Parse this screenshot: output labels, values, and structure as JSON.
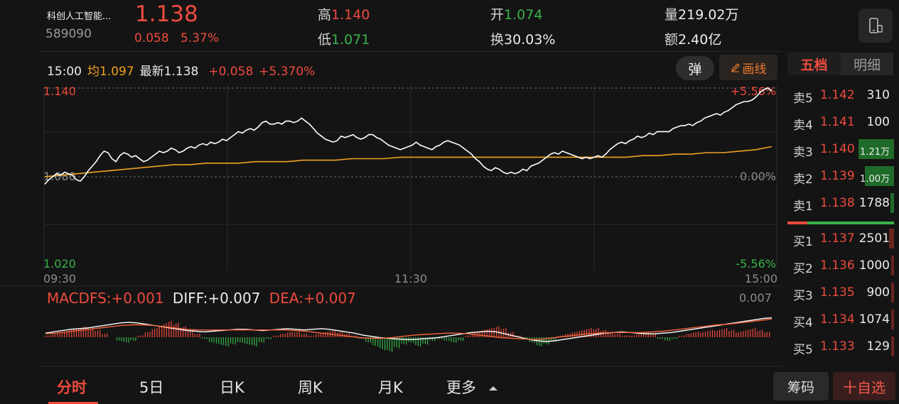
{
  "header": {
    "stock_name": "科创人工智能...",
    "stock_code": "589090",
    "last_price": "1.138",
    "price_change": "0.058",
    "pct_change": "5.37%",
    "high_label": "高",
    "high_value": "1.140",
    "low_label": "低",
    "low_value": "1.071",
    "open_label": "开",
    "open_value": "1.074",
    "turnover_rate_label": "换",
    "turnover_rate_value": "30.03%",
    "volume_label": "量",
    "volume_value": "219.02万",
    "amount_label": "额",
    "amount_value": "2.40亿"
  },
  "chart_info": {
    "time": "15:00",
    "avg_label": "均",
    "avg_value": "1.097",
    "latest_label": "最新",
    "latest_value": "1.138",
    "change": "+0.058",
    "change_pct": "+5.370%",
    "danmu_label": "弹",
    "draw_label": "画线"
  },
  "chart_data": [
    {
      "type": "line",
      "title": "",
      "x_ticks": [
        "09:30",
        "11:30",
        "15:00"
      ],
      "y_left_labels": [
        "1.140",
        "1.080",
        "1.020"
      ],
      "y_right_labels": [
        "+5.56%",
        "0.00%",
        "-5.56%"
      ],
      "ylim": [
        1.02,
        1.14
      ],
      "series": [
        {
          "values": [
            1.076,
            1.079,
            1.081,
            1.083,
            1.082,
            1.084,
            1.083,
            1.082,
            1.079,
            1.078,
            1.081,
            1.085,
            1.088,
            1.091,
            1.095,
            1.098,
            1.097,
            1.093,
            1.091,
            1.095,
            1.097,
            1.096,
            1.094,
            1.095,
            1.093,
            1.091,
            1.092,
            1.094,
            1.096,
            1.098,
            1.097,
            1.098,
            1.1,
            1.099,
            1.097,
            1.098,
            1.1,
            1.101,
            1.1,
            1.102,
            1.103,
            1.102,
            1.104,
            1.103,
            1.104,
            1.106,
            1.105,
            1.107,
            1.109,
            1.111,
            1.11,
            1.112,
            1.113,
            1.112,
            1.114,
            1.117,
            1.118,
            1.116,
            1.116,
            1.117,
            1.116,
            1.118,
            1.118,
            1.117,
            1.118,
            1.12,
            1.118,
            1.116,
            1.113,
            1.11,
            1.108,
            1.106,
            1.105,
            1.104,
            1.105,
            1.108,
            1.107,
            1.108,
            1.109,
            1.107,
            1.106,
            1.107,
            1.109,
            1.109,
            1.107,
            1.106,
            1.104,
            1.102,
            1.101,
            1.1,
            1.099,
            1.1,
            1.101,
            1.102,
            1.104,
            1.102,
            1.101,
            1.1,
            1.099,
            1.101,
            1.102,
            1.104,
            1.105,
            1.104,
            1.103,
            1.102,
            1.1,
            1.098,
            1.096,
            1.093,
            1.091,
            1.088,
            1.086,
            1.085,
            1.087,
            1.086,
            1.084,
            1.083,
            1.084,
            1.083,
            1.084,
            1.086,
            1.085,
            1.088,
            1.089,
            1.09,
            1.092,
            1.094,
            1.096,
            1.097,
            1.096,
            1.098,
            1.097,
            1.096,
            1.095,
            1.094,
            1.093,
            1.094,
            1.093,
            1.094,
            1.095,
            1.094,
            1.096,
            1.099,
            1.101,
            1.103,
            1.104,
            1.103,
            1.105,
            1.106,
            1.108,
            1.107,
            1.108,
            1.11,
            1.109,
            1.111,
            1.111,
            1.111,
            1.111,
            1.113,
            1.114,
            1.115,
            1.115,
            1.116,
            1.115,
            1.117,
            1.118,
            1.12,
            1.121,
            1.122,
            1.123,
            1.122,
            1.124,
            1.125,
            1.127,
            1.129,
            1.13,
            1.131,
            1.131,
            1.132,
            1.134,
            1.137,
            1.139,
            1.14,
            1.138
          ]
        },
        {
          "values": [
            1.081,
            1.082,
            1.083,
            1.084,
            1.085,
            1.086,
            1.087,
            1.088,
            1.089,
            1.089,
            1.09,
            1.09,
            1.09,
            1.091,
            1.091,
            1.091,
            1.092,
            1.092,
            1.092,
            1.093,
            1.093,
            1.093,
            1.094,
            1.094,
            1.094,
            1.094,
            1.094,
            1.094,
            1.094,
            1.094,
            1.094,
            1.094,
            1.094,
            1.094,
            1.094,
            1.094,
            1.094,
            1.095,
            1.095,
            1.096,
            1.096,
            1.097,
            1.097,
            1.098,
            1.099,
            1.101
          ]
        }
      ]
    },
    {
      "type": "bar",
      "title": "",
      "legend": [
        "MACDFS:+0.001",
        "DIFF:+0.007",
        "DEA:+0.007"
      ],
      "y_label_top": "0.007",
      "series": [
        {
          "values": [
            0.1,
            0.2,
            0.3,
            0.4,
            0.5,
            0.6,
            0.5,
            0.4,
            0.2,
            0.0,
            -0.2,
            -0.3,
            -0.2,
            0.1,
            0.3,
            0.5,
            0.7,
            0.9,
            0.8,
            0.6,
            0.4,
            0.2,
            -0.1,
            -0.3,
            -0.4,
            -0.5,
            -0.4,
            -0.3,
            -0.4,
            -0.5,
            -0.3,
            -0.1,
            0.1,
            0.2,
            0.3,
            0.3,
            0.2,
            0.1,
            0.2,
            0.3,
            0.4,
            0.3,
            0.2,
            0.1,
            -0.1,
            -0.3,
            -0.5,
            -0.7,
            -0.8,
            -0.6,
            -0.4,
            -0.3,
            -0.5,
            -0.4,
            -0.2,
            -0.1,
            -0.2,
            -0.3,
            -0.2,
            0.1,
            0.3,
            0.4,
            0.5,
            0.6,
            0.5,
            0.3,
            0.1,
            -0.1,
            -0.3,
            -0.5,
            -0.4,
            -0.2,
            0.1,
            0.2,
            0.3,
            0.4,
            0.5,
            0.5,
            0.4,
            0.3,
            0.2,
            0.1,
            0.1,
            0.2,
            0.3,
            0.2,
            -0.1,
            -0.2,
            -0.1,
            0.1,
            0.2,
            0.3,
            0.3,
            0.4,
            0.4,
            0.5,
            0.4,
            0.3,
            0.4,
            0.5,
            0.4,
            0.3
          ]
        },
        {
          "values": [
            0.2,
            0.4,
            0.6,
            0.8,
            0.9,
            1.0,
            1.2,
            1.4,
            1.6,
            1.8,
            1.9,
            1.8,
            1.6,
            1.4,
            1.2,
            1.0,
            0.8,
            0.6,
            0.5,
            0.4,
            0.5,
            0.6,
            0.7,
            0.8,
            0.8,
            0.7,
            0.6,
            0.7,
            0.8,
            0.9,
            0.8,
            0.7,
            0.8,
            0.9,
            0.8,
            0.6,
            0.4,
            0.2,
            -0.1,
            -0.3,
            -0.5,
            -0.6,
            -0.7,
            -0.8,
            -0.8,
            -0.7,
            -0.6,
            -0.5,
            -0.3,
            -0.1,
            0.1,
            0.3,
            0.4,
            0.5,
            0.4,
            0.1,
            -0.2,
            -0.5,
            -0.8,
            -1.0,
            -1.1,
            -1.0,
            -0.8,
            -0.6,
            -0.4,
            -0.2,
            0.0,
            0.2,
            0.3,
            0.4,
            0.3,
            0.2,
            0.1,
            0.1,
            0.2,
            0.3,
            0.5,
            0.7,
            0.9,
            1.1,
            1.3,
            1.5,
            1.7,
            1.9,
            2.1,
            2.3,
            2.5,
            2.6
          ]
        },
        {
          "values": [
            0.1,
            0.2,
            0.4,
            0.6,
            0.8,
            1.0,
            1.2,
            1.4,
            1.5,
            1.5,
            1.4,
            1.2,
            1.0,
            0.8,
            0.7,
            0.7,
            0.7,
            0.7,
            0.7,
            0.7,
            0.7,
            0.7,
            0.7,
            0.6,
            0.5,
            0.3,
            0.1,
            -0.1,
            -0.3,
            -0.5,
            -0.6,
            -0.6,
            -0.5,
            -0.3,
            -0.1,
            0.0,
            0.1,
            0.2,
            0.2,
            0.1,
            -0.1,
            -0.3,
            -0.5,
            -0.6,
            -0.7,
            -0.8,
            -0.7,
            -0.5,
            -0.3,
            -0.1,
            0.1,
            0.2,
            0.3,
            0.3,
            0.3,
            0.3,
            0.4,
            0.5,
            0.7,
            0.9,
            1.1,
            1.3,
            1.5,
            1.6,
            1.8,
            2.0,
            2.2,
            2.4
          ]
        }
      ]
    }
  ],
  "orderbook": {
    "tab_five": "五档",
    "tab_detail": "明细",
    "asks": [
      {
        "label": "卖5",
        "price": "1.142",
        "volume": "310",
        "bar": 0
      },
      {
        "label": "卖4",
        "price": "1.141",
        "volume": "100",
        "bar": 0
      },
      {
        "label": "卖3",
        "price": "1.140",
        "volume": "1.21万",
        "bar": 1.0
      },
      {
        "label": "卖2",
        "price": "1.139",
        "volume": "1.00万",
        "bar": 0.83
      },
      {
        "label": "卖1",
        "price": "1.138",
        "volume": "1788",
        "bar": 0.1
      }
    ],
    "bids": [
      {
        "label": "买1",
        "price": "1.137",
        "volume": "2501",
        "bar": 0.15
      },
      {
        "label": "买2",
        "price": "1.136",
        "volume": "1000",
        "bar": 0.07
      },
      {
        "label": "买3",
        "price": "1.135",
        "volume": "900",
        "bar": 0.07
      },
      {
        "label": "买4",
        "price": "1.134",
        "volume": "1074",
        "bar": 0.08
      },
      {
        "label": "买5",
        "price": "1.133",
        "volume": "129",
        "bar": 0.03
      }
    ]
  },
  "bottom_tabs": {
    "intraday": "分时",
    "five_day": "5日",
    "daily_k": "日K",
    "weekly_k": "周K",
    "monthly_k": "月K",
    "more": "更多",
    "chips": "筹码",
    "add_watch": "十自选"
  },
  "icons": {
    "phone": "phone-icon",
    "pencil": "pencil-icon",
    "caret_up": "caret-up-icon"
  },
  "colors": {
    "up": "#ee4b3e",
    "down": "#37b34a",
    "price_line": "#ffffff",
    "avg_line": "#f0a21f"
  }
}
